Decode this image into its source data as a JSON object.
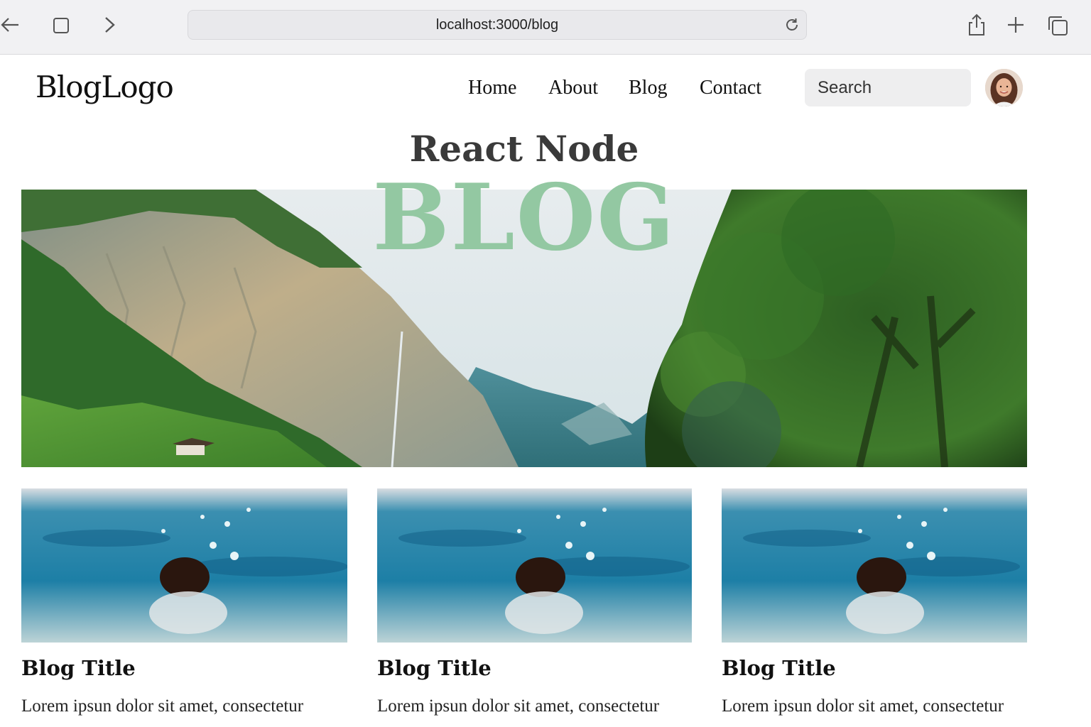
{
  "browser": {
    "url": "localhost:3000/blog"
  },
  "header": {
    "logo": "BlogLogo",
    "nav": [
      {
        "label": "Home"
      },
      {
        "label": "About"
      },
      {
        "label": "Blog"
      },
      {
        "label": "Contact"
      }
    ],
    "search_placeholder": "Search"
  },
  "hero": {
    "top_title": "React Node",
    "big_title": "BLOG",
    "big_title_color": "#93c8a2"
  },
  "cards": [
    {
      "title": "Blog Title",
      "excerpt": "Lorem ipsun dolor sit amet, consectetur"
    },
    {
      "title": "Blog Title",
      "excerpt": "Lorem ipsun dolor sit amet, consectetur"
    },
    {
      "title": "Blog Title",
      "excerpt": "Lorem ipsun dolor sit amet, consectetur"
    }
  ]
}
